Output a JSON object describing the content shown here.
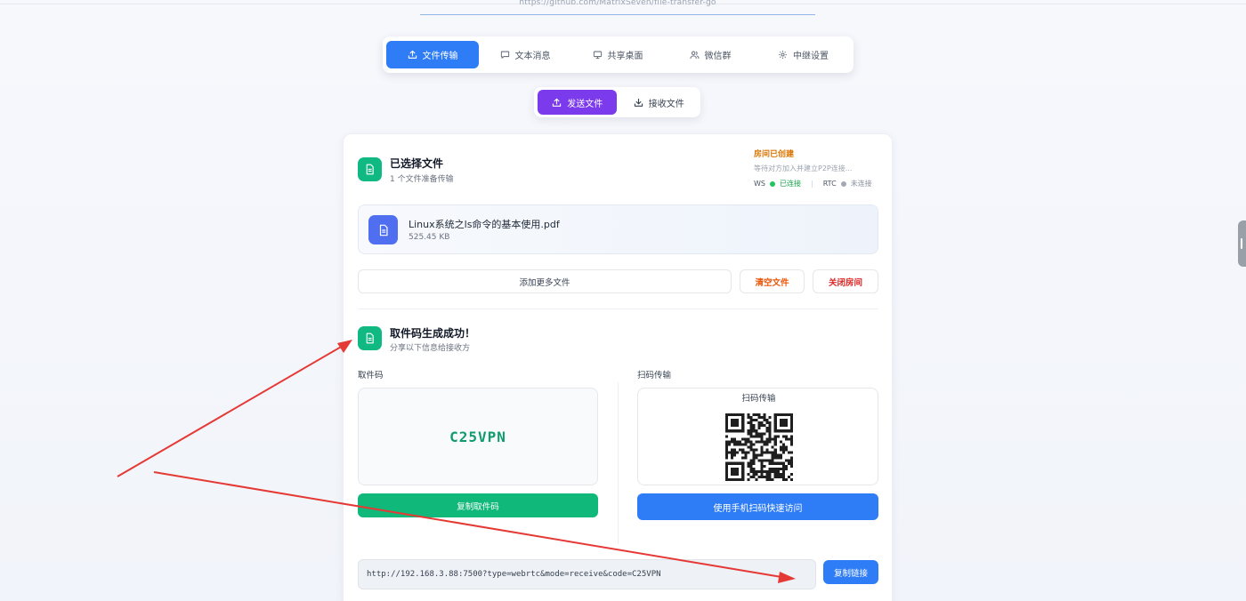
{
  "header": {
    "repo_link": "https://github.com/MatrixSeven/file-transfer-go"
  },
  "main_tabs": [
    {
      "label": "文件传输",
      "icon": "upload-icon",
      "active": true
    },
    {
      "label": "文本消息",
      "icon": "message-icon",
      "active": false
    },
    {
      "label": "共享桌面",
      "icon": "monitor-icon",
      "active": false
    },
    {
      "label": "微信群",
      "icon": "users-icon",
      "active": false
    },
    {
      "label": "中继设置",
      "icon": "gear-icon",
      "active": false
    }
  ],
  "sub_tabs": [
    {
      "label": "发送文件",
      "icon": "upload-icon",
      "active": true
    },
    {
      "label": "接收文件",
      "icon": "download-icon",
      "active": false
    }
  ],
  "selected": {
    "title": "已选择文件",
    "subtitle": "1 个文件准备传输"
  },
  "room": {
    "status": "房间已创建",
    "description": "等待对方加入并建立P2P连接...",
    "ws_label": "WS",
    "ws_status": "已连接",
    "rtc_label": "RTC",
    "rtc_status": "未连接"
  },
  "file": {
    "name": "Linux系统之ls命令的基本使用.pdf",
    "size": "525.45 KB"
  },
  "actions": {
    "add_more": "添加更多文件",
    "clear": "清空文件",
    "close_room": "关闭房间"
  },
  "success": {
    "title": "取件码生成成功！",
    "subtitle": "分享以下信息给接收方"
  },
  "pickup": {
    "label": "取件码",
    "code": "C25VPN",
    "copy_button": "复制取件码"
  },
  "qr": {
    "label": "扫码传输",
    "box_title": "扫码传输",
    "scan_button": "使用手机扫码快速访问"
  },
  "link": {
    "url": "http://192.168.3.88:7500?type=webrtc&mode=receive&code=C25VPN",
    "copy_button": "复制链接"
  },
  "colors": {
    "primary_blue": "#2f7df6",
    "purple": "#7c3aed",
    "green": "#10b981",
    "warning": "#d97706",
    "danger": "#dc2626",
    "annotation_red": "#e53935"
  }
}
